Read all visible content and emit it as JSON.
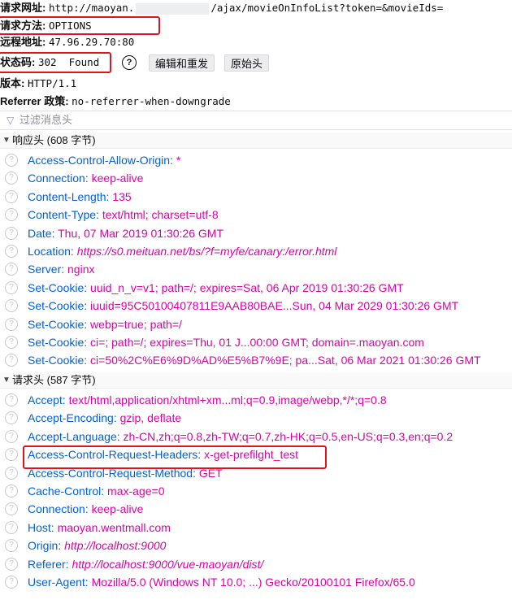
{
  "summary": {
    "url_label": "请求网址:",
    "url_prefix": "http://maoyan.",
    "url_suffix": "/ajax/movieOnInfoList?token=&movieIds=",
    "method_label": "请求方法:",
    "method_value": "OPTIONS",
    "remote_label": "远程地址:",
    "remote_value": "47.96.29.70:80",
    "status_label": "状态码:",
    "status_value": "302  Found",
    "edit_resend_label": "编辑和重发",
    "raw_headers_label": "原始头",
    "version_label": "版本:",
    "version_value": "HTTP/1.1",
    "referrer_label": "Referrer 政策:",
    "referrer_value": "no-referrer-when-downgrade"
  },
  "filter": {
    "placeholder": "过滤消息头"
  },
  "response": {
    "title": "响应头 (608 字节)",
    "headers": [
      {
        "name": "Access-Control-Allow-Origin:",
        "value": "*",
        "italic": false
      },
      {
        "name": "Connection:",
        "value": "keep-alive",
        "italic": false
      },
      {
        "name": "Content-Length:",
        "value": "135",
        "italic": false
      },
      {
        "name": "Content-Type:",
        "value": "text/html; charset=utf-8",
        "italic": false
      },
      {
        "name": "Date:",
        "value": "Thu, 07 Mar 2019 01:30:26 GMT",
        "italic": false
      },
      {
        "name": "Location:",
        "value": "https://s0.meituan.net/bs/?f=myfe/canary:/error.html",
        "italic": true
      },
      {
        "name": "Server:",
        "value": "nginx",
        "italic": false
      },
      {
        "name": "Set-Cookie:",
        "value": "uuid_n_v=v1; path=/; expires=Sat, 06 Apr 2019 01:30:26 GMT",
        "italic": false
      },
      {
        "name": "Set-Cookie:",
        "value": "iuuid=95C50100407811E9AAB80BAE...Sun, 04 Mar 2029 01:30:26 GMT",
        "italic": false
      },
      {
        "name": "Set-Cookie:",
        "value": "webp=true; path=/",
        "italic": false
      },
      {
        "name": "Set-Cookie:",
        "value": "ci=; path=/; expires=Thu, 01 J...00:00 GMT; domain=.maoyan.com",
        "italic": false
      },
      {
        "name": "Set-Cookie:",
        "value": "ci=50%2C%E6%9D%AD%E5%B7%9E; pa...Sat, 06 Mar 2021 01:30:26 GMT",
        "italic": false
      }
    ]
  },
  "request": {
    "title": "请求头 (587 字节)",
    "headers": [
      {
        "name": "Accept:",
        "value": "text/html,application/xhtml+xm...ml;q=0.9,image/webp,*/*;q=0.8",
        "italic": false
      },
      {
        "name": "Accept-Encoding:",
        "value": "gzip, deflate",
        "italic": false
      },
      {
        "name": "Accept-Language:",
        "value": "zh-CN,zh;q=0.8,zh-TW;q=0.7,zh-HK;q=0.5,en-US;q=0.3,en;q=0.2",
        "italic": false
      },
      {
        "name": "Access-Control-Request-Headers:",
        "value": "x-get-prefilght_test",
        "italic": false
      },
      {
        "name": "Access-Control-Request-Method:",
        "value": "GET",
        "italic": false
      },
      {
        "name": "Cache-Control:",
        "value": "max-age=0",
        "italic": false
      },
      {
        "name": "Connection:",
        "value": "keep-alive",
        "italic": false
      },
      {
        "name": "Host:",
        "value": "maoyan.wentmall.com",
        "italic": false
      },
      {
        "name": "Origin:",
        "value": "http://localhost:9000",
        "italic": true
      },
      {
        "name": "Referer:",
        "value": "http://localhost:9000/vue-maoyan/dist/",
        "italic": true
      },
      {
        "name": "User-Agent:",
        "value": "Mozilla/5.0 (Windows NT 10.0; ...) Gecko/20100101 Firefox/65.0",
        "italic": false
      }
    ]
  },
  "colors": {
    "highlight_box": "#e0141f",
    "header_name": "#0060df",
    "header_value": "#dd00a9"
  },
  "icons": {
    "help": "question-circle-icon",
    "filter": "filter-icon",
    "row_help": "question-circle-icon",
    "collapse": "triangle-down-icon"
  }
}
